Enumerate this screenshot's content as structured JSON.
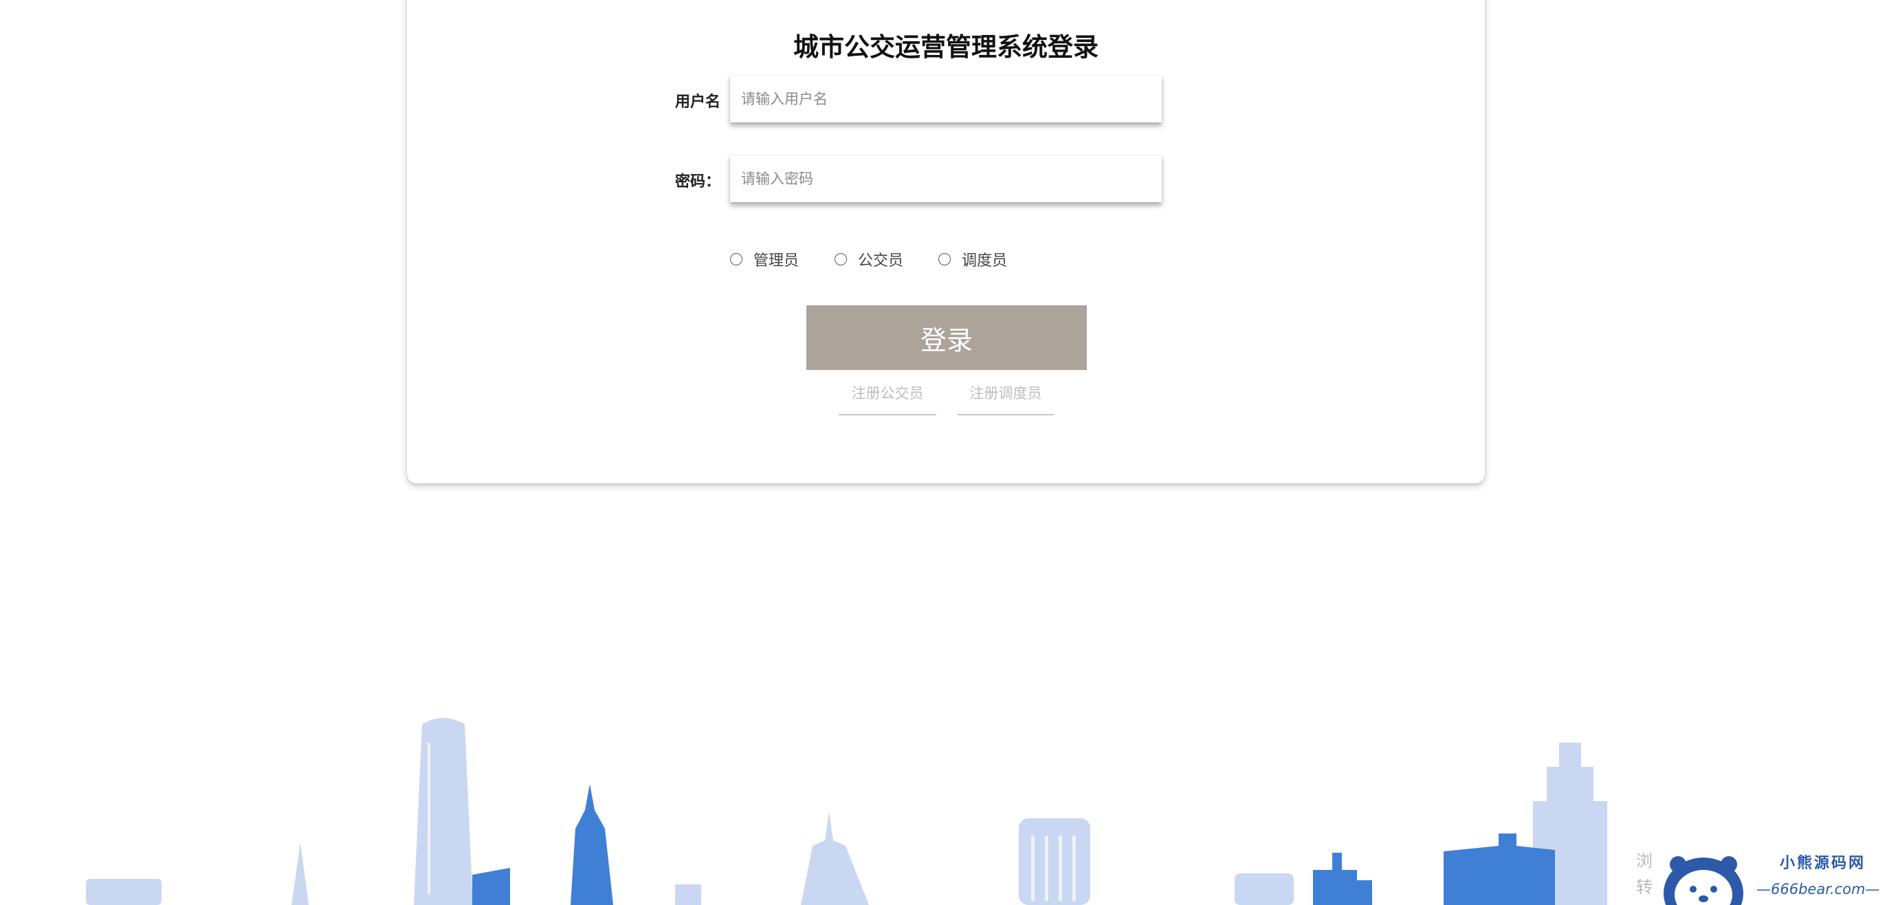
{
  "login": {
    "title": "城市公交运营管理系统登录",
    "username_label": "用户名",
    "username_placeholder": "请输入用户名",
    "password_label": "密码：",
    "password_placeholder": "请输入密码",
    "roles": [
      "管理员",
      "公交员",
      "调度员"
    ],
    "login_button": "登录",
    "register_links": [
      "注册公交员",
      "注册调度员"
    ]
  },
  "watermark": {
    "side_text": [
      "浏",
      "转"
    ],
    "title": "小熊源码网",
    "url": "—666bear.com—"
  },
  "colors": {
    "button_bg": "#aca39b",
    "skyline_light": "#c9d7f2",
    "skyline_dark": "#3f7fd6",
    "brand": "#2d5aa8"
  }
}
